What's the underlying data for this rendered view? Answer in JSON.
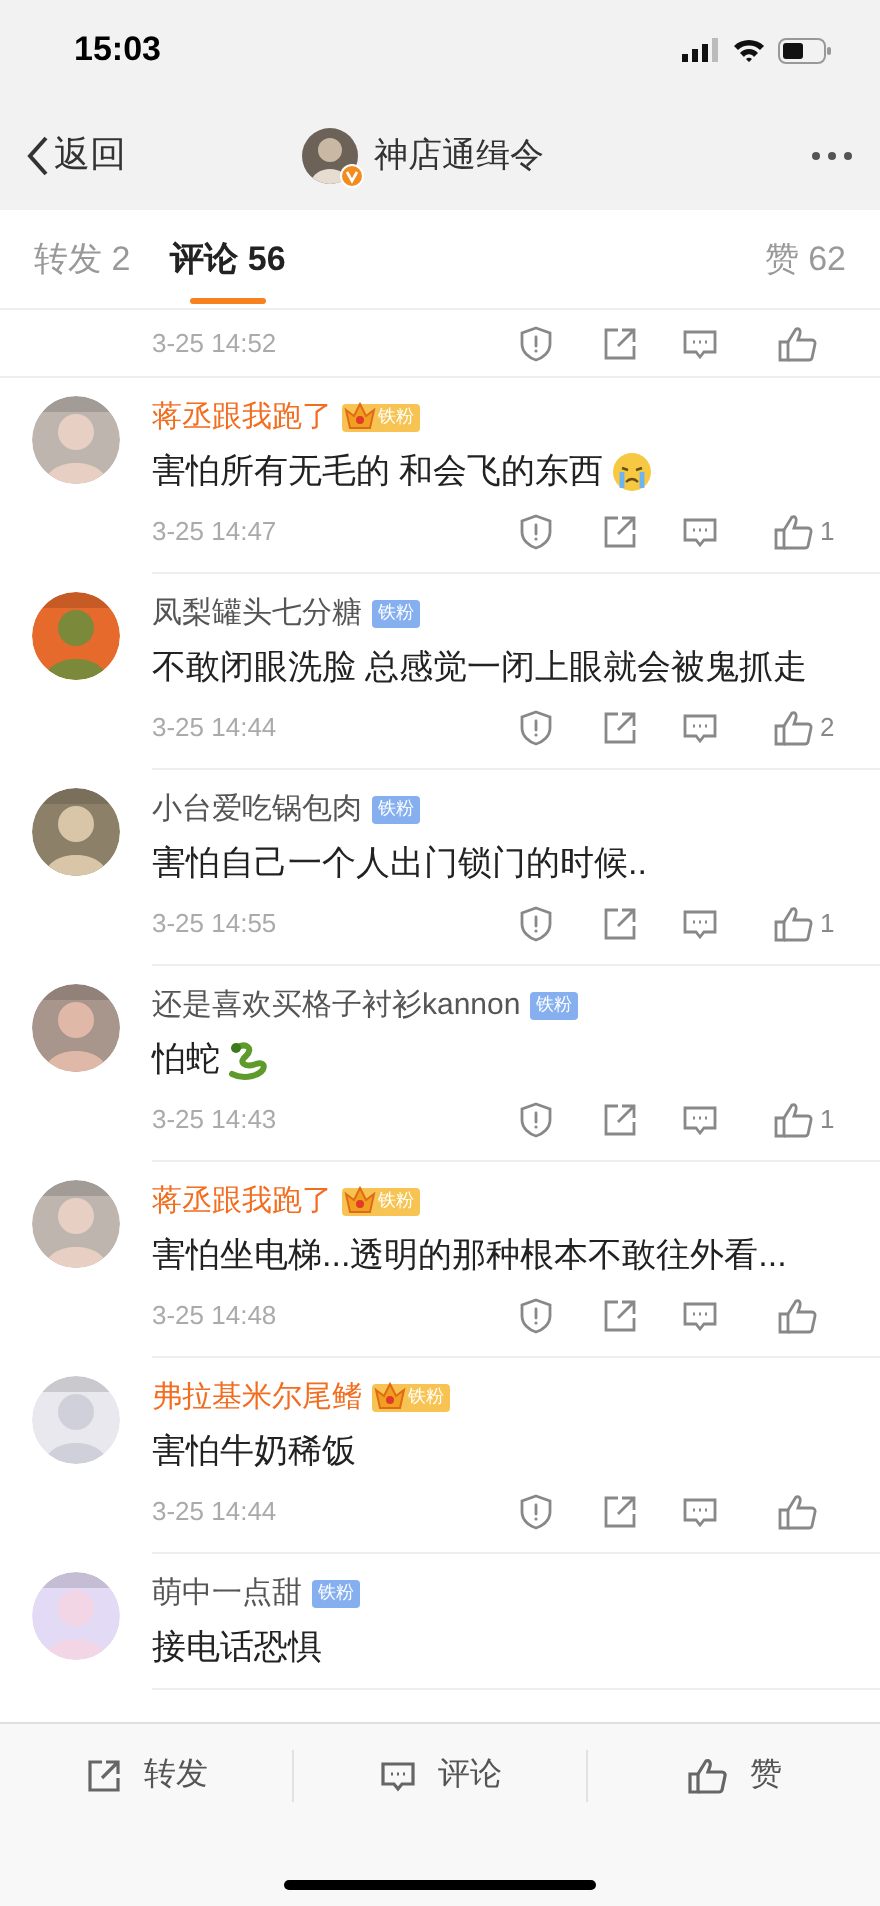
{
  "status_bar": {
    "time": "15:03"
  },
  "nav": {
    "back": "返回",
    "title": "神店通缉令",
    "verified": true
  },
  "tabs": [
    {
      "label": "转发 2",
      "selected": false
    },
    {
      "label": "评论 56",
      "selected": true
    },
    {
      "label": "赞 62",
      "selected": false
    }
  ],
  "top_partial": {
    "time": "3-25 14:52"
  },
  "comments": [
    {
      "name": "蒋丞跟我跑了",
      "vip": true,
      "badge": "铁粉",
      "text": "害怕所有无毛的 和会飞的东西",
      "kind": "crying",
      "time": "3-25 14:47",
      "likes": "1"
    },
    {
      "name": "凤梨罐头七分糖",
      "vip": false,
      "badge": "铁粉",
      "text": "不敢闭眼洗脸 总感觉一闭上眼就会被鬼抓走",
      "time": "3-25 14:44",
      "likes": "2",
      "kind": "plain"
    },
    {
      "name": "小台爱吃锅包肉",
      "vip": false,
      "badge": "铁粉",
      "text": "害怕自己一个人出门锁门的时候..",
      "time": "3-25 14:55",
      "likes": "1",
      "kind": "plain"
    },
    {
      "name": "还是喜欢买格子衬衫kannon",
      "vip": false,
      "badge": "铁粉",
      "text": "怕蛇",
      "kind": "snake",
      "time": "3-25 14:43",
      "likes": "1"
    },
    {
      "name": "蒋丞跟我跑了",
      "vip": true,
      "badge": "铁粉",
      "text": "害怕坐电梯...透明的那种根本不敢往外看...",
      "time": "3-25 14:48",
      "kind": "plain"
    },
    {
      "name": "弗拉基米尔尾鳍",
      "vip": true,
      "badge": "铁粉",
      "text": "害怕牛奶稀饭",
      "time": "3-25 14:44",
      "kind": "plain"
    },
    {
      "name": "萌中一点甜",
      "vip": false,
      "badge": "铁粉",
      "text": "接电话恐惧",
      "kind": "plain"
    }
  ],
  "bottom_bar": [
    {
      "kind": "repost",
      "label": "转发"
    },
    {
      "kind": "comment",
      "label": "评论"
    },
    {
      "kind": "like",
      "label": "赞"
    }
  ]
}
